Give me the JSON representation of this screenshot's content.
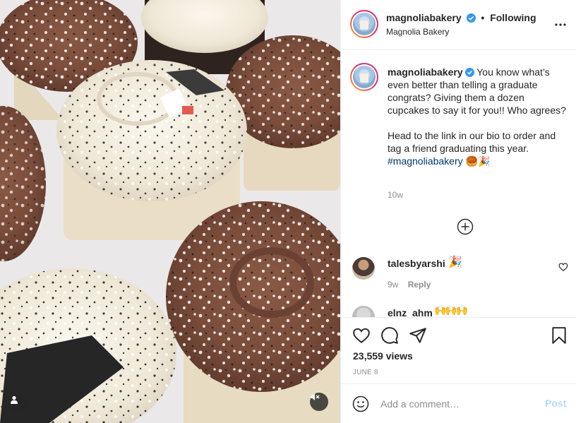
{
  "header": {
    "username": "magnoliabakery",
    "separator": "•",
    "follow_status": "Following",
    "location": "Magnolia Bakery"
  },
  "caption": {
    "username": "magnoliabakery",
    "text": "You know what’s even better than telling a graduate congrats? Giving them a dozen cupcakes to say it for you!! Who agrees?",
    "text2": "Head to the link in our bio to order and tag a friend graduating this year.",
    "hashtag": "#magnoliabakery",
    "emoji": "🥮🎉",
    "time": "10w"
  },
  "comments": [
    {
      "username": "talesbyarshi",
      "emoji": "🎉",
      "time": "9w",
      "reply_label": "Reply"
    },
    {
      "username": "elnz_ahm",
      "emoji": "🙌🙌🙌"
    }
  ],
  "post": {
    "views": "23,559 views",
    "date": "JUNE 8"
  },
  "add_comment": {
    "placeholder": "Add a comment…",
    "post_label": "Post"
  },
  "colors": {
    "link": "#00376b",
    "verified": "#3897f0",
    "post_disabled": "#b3dbff",
    "muted_text": "#8e8e8e"
  },
  "icons": [
    "verified-badge-icon",
    "more-options-icon",
    "load-more-comments-icon",
    "heart-icon",
    "comment-icon",
    "share-icon",
    "bookmark-icon",
    "emoji-icon",
    "user-tag-icon",
    "muted-speaker-icon"
  ]
}
